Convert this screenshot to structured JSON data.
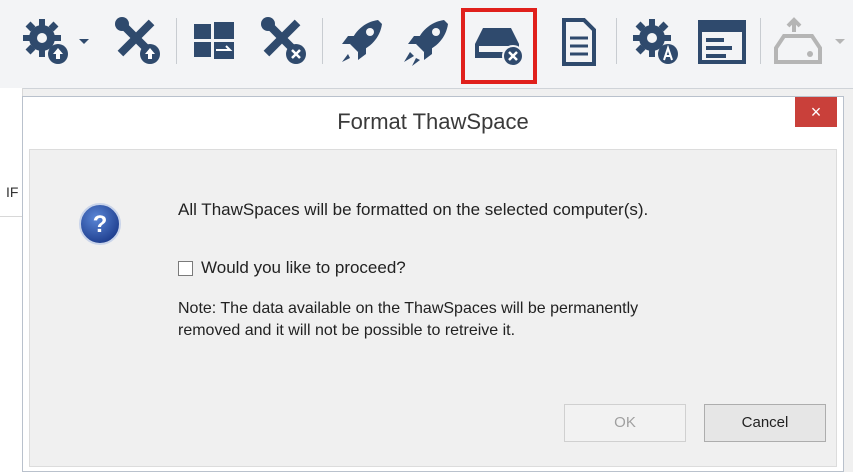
{
  "toolbar": {
    "buttons": [
      {
        "name": "settings-upload-icon",
        "color": "#2f4a6d"
      },
      {
        "name": "tools-upload-icon",
        "color": "#2f4a6d"
      },
      {
        "name": "windows-update-icon",
        "color": "#2f4a6d"
      },
      {
        "name": "tools-remove-icon",
        "color": "#2f4a6d"
      },
      {
        "name": "rocket-icon",
        "color": "#2f4a6d"
      },
      {
        "name": "rocket-double-icon",
        "color": "#2f4a6d"
      },
      {
        "name": "drive-remove-icon",
        "color": "#2f4a6d",
        "highlighted": true
      },
      {
        "name": "document-icon",
        "color": "#2f4a6d"
      },
      {
        "name": "settings-a-icon",
        "color": "#2f4a6d"
      },
      {
        "name": "window-icon",
        "color": "#2f4a6d"
      },
      {
        "name": "drive-disabled-icon",
        "color": "#b5b5b5"
      }
    ],
    "highlight_color": "#e0201c"
  },
  "background": {
    "column_fragment": "IF"
  },
  "dialog": {
    "title": "Format ThawSpace",
    "close_label": "×",
    "message": "All ThawSpaces will be formatted on the selected computer(s).",
    "checkbox_label": "Would you like to proceed?",
    "checkbox_checked": false,
    "note_line1": "Note: The data available on the ThawSpaces will be permanently",
    "note_line2": "removed and it will not be possible to retreive it.",
    "ok_label": "OK",
    "ok_enabled": false,
    "cancel_label": "Cancel",
    "icon": "question-icon"
  }
}
